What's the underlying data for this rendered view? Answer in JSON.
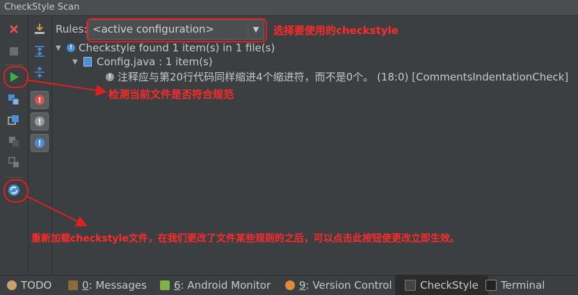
{
  "window": {
    "title": "CheckStyle Scan"
  },
  "toolbar": {
    "rules_label": "Rules:",
    "rules_value": "<active configuration>"
  },
  "tree": {
    "root": "Checkstyle found 1 item(s) in 1 file(s)",
    "file": "Config.java : 1 item(s)",
    "item": "注释应与第20行代码同样缩进4个缩进符，而不是0个。 (18:0) [CommentsIndentationCheck]"
  },
  "annotations": {
    "select_rules": "选择要使用的checkstyle",
    "check_file": "检测当前文件是否符合规范",
    "reload": "重新加载checkstyle文件，在我们更改了文件某些规则的之后，可以点击此按钮使更改立即生效。"
  },
  "bottom_tabs": [
    {
      "mnemonic": "",
      "label": "TODO"
    },
    {
      "mnemonic": "0",
      "label": ": Messages"
    },
    {
      "mnemonic": "6",
      "label": ": Android Monitor"
    },
    {
      "mnemonic": "9",
      "label": ": Version Control"
    },
    {
      "mnemonic": "",
      "label": "CheckStyle"
    },
    {
      "mnemonic": "",
      "label": "Terminal"
    }
  ],
  "colors": {
    "annotation": "#ff2a2a",
    "accent_blue": "#4a8fd8",
    "run_green": "#3cb043",
    "error_red": "#d9534f"
  }
}
